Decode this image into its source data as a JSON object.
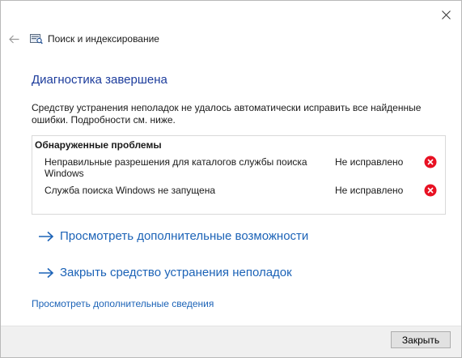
{
  "window": {
    "title": "Поиск и индексирование",
    "close_icon": "close-icon",
    "back_icon": "back-arrow-icon",
    "app_icon": "search-indexing-icon"
  },
  "main": {
    "heading": "Диагностика завершена",
    "description": "Средству устранения неполадок не удалось автоматически исправить все найденные ошибки. Подробности см. ниже."
  },
  "problems": {
    "title": "Обнаруженные проблемы",
    "items": [
      {
        "name": "Неправильные разрешения для каталогов службы поиска Windows",
        "status": "Не исправлено",
        "icon": "error-icon"
      },
      {
        "name": "Служба поиска Windows не запущена",
        "status": "Не исправлено",
        "icon": "error-icon"
      }
    ]
  },
  "actions": {
    "more_options": "Просмотреть дополнительные возможности",
    "close_troubleshooter": "Закрыть средство устранения неполадок",
    "details_link": "Просмотреть дополнительные сведения"
  },
  "footer": {
    "close_label": "Закрыть"
  },
  "colors": {
    "heading": "#1c3c9c",
    "link": "#1c63b7",
    "error": "#e81123",
    "footer_bg": "#f0f0f0"
  }
}
